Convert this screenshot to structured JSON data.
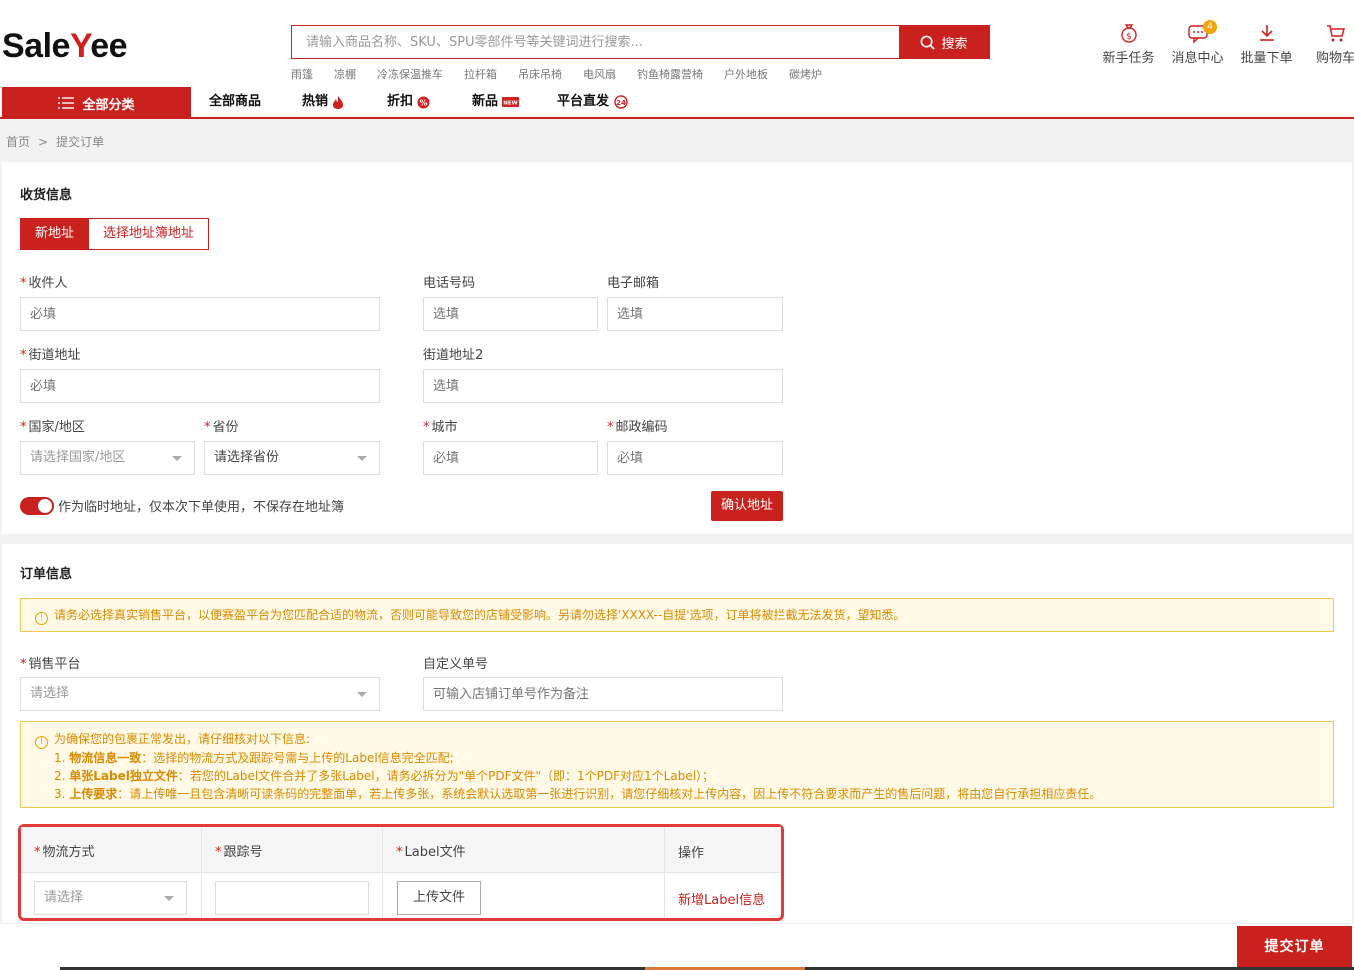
{
  "brand": {
    "logo_part1": "Sale",
    "logo_part2": "Y",
    "logo_part3": "ee"
  },
  "search": {
    "placeholder": "请输入商品名称、SKU、SPU零部件号等关键词进行搜索...",
    "button": "搜索"
  },
  "hot_words": [
    "雨篷",
    "凉棚",
    "冷冻保温推车",
    "拉杆箱",
    "吊床吊椅",
    "电风扇",
    "钓鱼椅露营椅",
    "户外地板",
    "碳烤炉"
  ],
  "top_icons": [
    {
      "label": "新手任务",
      "icon": "money-bag-icon"
    },
    {
      "label": "消息中心",
      "icon": "message-icon",
      "badge": "4"
    },
    {
      "label": "批量下单",
      "icon": "download-icon"
    },
    {
      "label": "购物车",
      "icon": "cart-icon"
    }
  ],
  "nav": {
    "all_categories": "全部分类",
    "items": [
      {
        "label": "全部商品"
      },
      {
        "label": "热销",
        "icon": "fire-icon"
      },
      {
        "label": "折扣",
        "icon": "discount-icon"
      },
      {
        "label": "新品",
        "icon": "new-icon",
        "icon_text": "NEW"
      },
      {
        "label": "平台直发",
        "icon": "24h-icon",
        "icon_text": "24"
      }
    ]
  },
  "breadcrumb": {
    "home": "首页",
    "sep": ">",
    "current": "提交订单"
  },
  "shipping": {
    "title": "收货信息",
    "tab_new": "新地址",
    "tab_book": "选择地址簿地址",
    "recipient_label": "收件人",
    "recipient_placeholder": "必填",
    "phone_label": "电话号码",
    "phone_placeholder": "选填",
    "email_label": "电子邮箱",
    "email_placeholder": "选填",
    "street_label": "街道地址",
    "street_placeholder": "必填",
    "street2_label": "街道地址2",
    "street2_placeholder": "选填",
    "country_label": "国家/地区",
    "country_value": "请选择国家/地区",
    "province_label": "省份",
    "province_value": "请选择省份",
    "city_label": "城市",
    "city_placeholder": "必填",
    "zip_label": "邮政编码",
    "zip_placeholder": "必填",
    "temp_toggle": "作为临时地址，仅本次下单使用，不保存在地址簿",
    "confirm_button": "确认地址"
  },
  "order": {
    "title": "订单信息",
    "notice1": "请务必选择真实销售平台，以便赛盈平台为您匹配合适的物流，否则可能导致您的店铺受影响。另请勿选择'XXXX--自提'选项，订单将被拦截无法发货，望知悉。",
    "platform_label": "销售平台",
    "platform_value": "请选择",
    "custom_no_label": "自定义单号",
    "custom_no_placeholder": "可输入店铺订单号作为备注",
    "notice2_title": "为确保您的包裹正常发出，请仔细核对以下信息:",
    "notice2_items": [
      {
        "prefix": "1. ",
        "bold": "物流信息一致",
        "text": "：选择的物流方式及跟踪号需与上传的Label信息完全匹配;"
      },
      {
        "prefix": "2. ",
        "bold": "单张Label独立文件",
        "text": "：若您的Label文件合并了多张Label，请务必拆分为\"单个PDF文件\"（即：1个PDF对应1个Label）；"
      },
      {
        "prefix": "3. ",
        "bold": "上传要求",
        "text": "：请上传唯一且包含清晰可读条码的完整面单，若上传多张，系统会默认选取第一张进行识别，请您仔细核对上传内容，因上传不符合要求而产生的售后问题，将由您自行承担相应责任。"
      }
    ],
    "table": {
      "col_method": "物流方式",
      "col_tracking": "跟踪号",
      "col_label": "Label文件",
      "col_action": "操作",
      "method_value": "请选择",
      "tracking_value": "",
      "upload_button": "上传文件",
      "add_link": "新增Label信息"
    }
  },
  "submit_button": "提交订单",
  "colors": {
    "accent": "#c9211e",
    "warning": "#d98a00",
    "warning_bg": "#fff9e6"
  }
}
